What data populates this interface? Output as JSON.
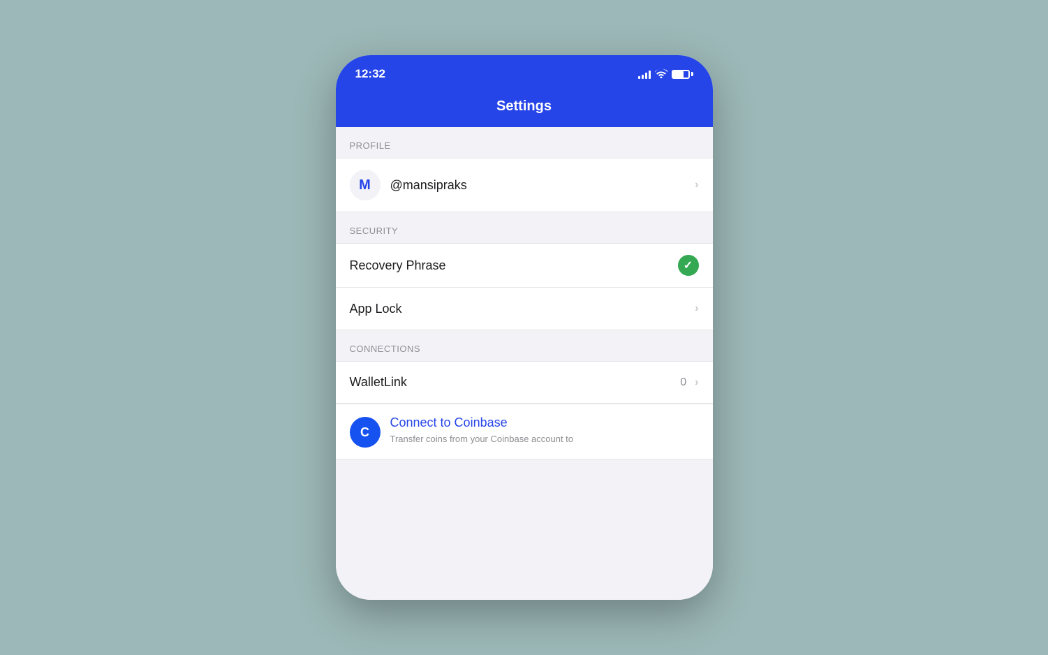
{
  "statusBar": {
    "time": "12:32",
    "signalBars": [
      3,
      5,
      7,
      9,
      11
    ],
    "batteryPercent": 70
  },
  "navBar": {
    "title": "Settings"
  },
  "sections": {
    "profile": {
      "label": "PROFILE",
      "items": [
        {
          "type": "profile",
          "avatarLetter": "M",
          "username": "@mansipraks",
          "hasChevron": true
        }
      ]
    },
    "security": {
      "label": "SECURITY",
      "items": [
        {
          "type": "checkmark",
          "label": "Recovery Phrase",
          "hasCheck": true,
          "hasChevron": false
        },
        {
          "type": "chevron",
          "label": "App Lock",
          "hasChevron": true
        }
      ]
    },
    "connections": {
      "label": "CONNECTIONS",
      "items": [
        {
          "type": "badge",
          "label": "WalletLink",
          "badgeCount": "0",
          "hasChevron": true
        },
        {
          "type": "connect",
          "title": "Connect to Coinbase",
          "subtitle": "Transfer coins from your Coinbase account to"
        }
      ]
    }
  },
  "icons": {
    "chevron": "›",
    "checkmark": "✓"
  }
}
